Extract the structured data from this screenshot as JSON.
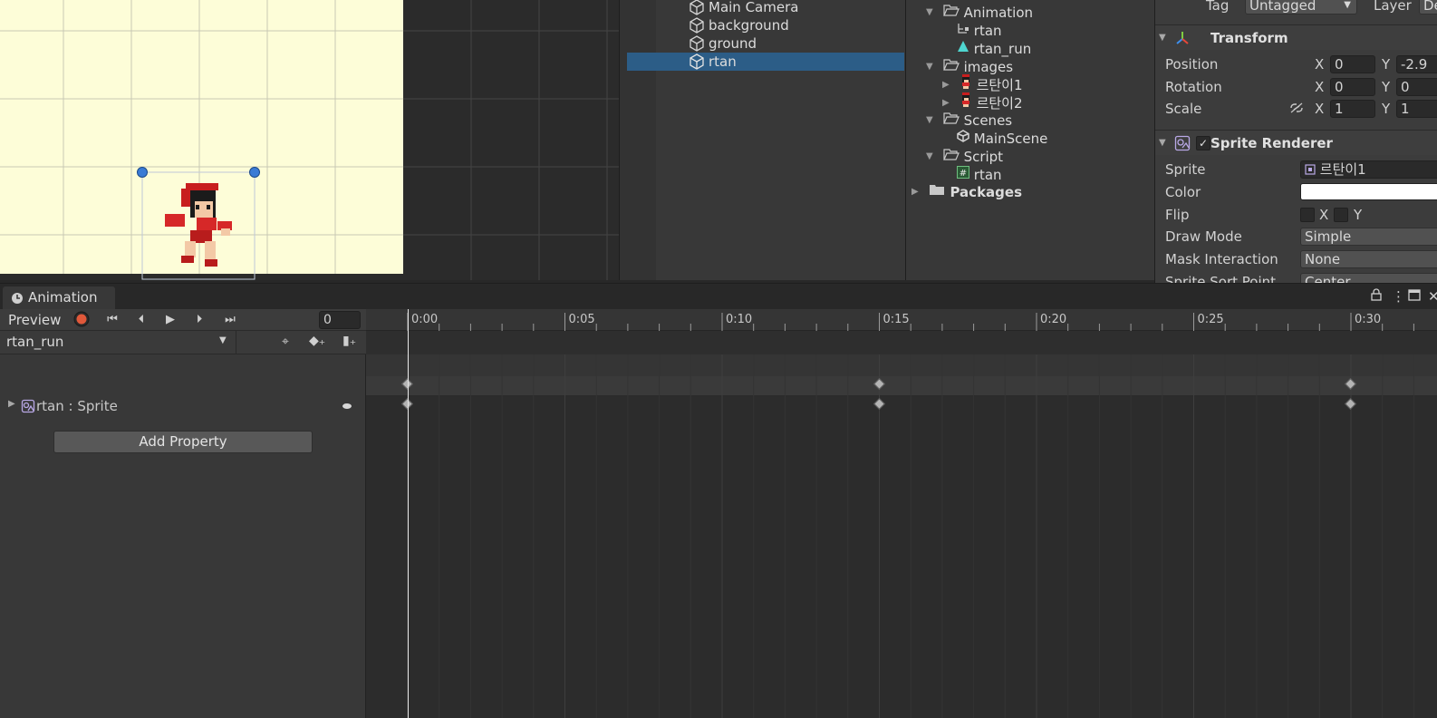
{
  "hierarchy": {
    "items": [
      {
        "label": "Main Camera",
        "selected": false
      },
      {
        "label": "background",
        "selected": false
      },
      {
        "label": "ground",
        "selected": false
      },
      {
        "label": "rtan",
        "selected": true
      }
    ]
  },
  "project": {
    "items": [
      {
        "label": "Animation",
        "kind": "folder-open",
        "indent": 1
      },
      {
        "label": "rtan",
        "kind": "animator-controller",
        "indent": 2
      },
      {
        "label": "rtan_run",
        "kind": "animation-clip",
        "indent": 2
      },
      {
        "label": "images",
        "kind": "folder-open",
        "indent": 1
      },
      {
        "label": "르탄이1",
        "kind": "sprite",
        "indent": 2
      },
      {
        "label": "르탄이2",
        "kind": "sprite",
        "indent": 2
      },
      {
        "label": "Scenes",
        "kind": "folder-open",
        "indent": 1
      },
      {
        "label": "MainScene",
        "kind": "scene",
        "indent": 2
      },
      {
        "label": "Script",
        "kind": "folder-open",
        "indent": 1
      },
      {
        "label": "rtan",
        "kind": "script",
        "indent": 2
      },
      {
        "label": "Packages",
        "kind": "folder-closed",
        "indent": 0
      }
    ]
  },
  "inspector": {
    "tag_label": "Tag",
    "tag_value": "Untagged",
    "layer_label": "Layer",
    "layer_value": "De",
    "transform": {
      "title": "Transform",
      "position_label": "Position",
      "rotation_label": "Rotation",
      "scale_label": "Scale",
      "x_label": "X",
      "y_label": "Y",
      "position_x": "0",
      "position_y": "-2.9",
      "rotation_x": "0",
      "rotation_y": "0",
      "scale_x": "1",
      "scale_y": "1"
    },
    "sprite_renderer": {
      "title": "Sprite Renderer",
      "sprite_label": "Sprite",
      "sprite_value": "르탄이1",
      "color_label": "Color",
      "flip_label": "Flip",
      "flip_x": "X",
      "flip_y": "Y",
      "draw_mode_label": "Draw Mode",
      "draw_mode_value": "Simple",
      "mask_label": "Mask Interaction",
      "mask_value": "None",
      "sort_point_label": "Sprite Sort Point",
      "sort_point_value": "Center"
    }
  },
  "animation": {
    "tab_label": "Animation",
    "preview_label": "Preview",
    "frame_value": "0",
    "clip_name": "rtan_run",
    "property_label": "rtan : Sprite",
    "add_property_label": "Add Property",
    "ruler_labels": [
      "0:00",
      "0:05",
      "0:10",
      "0:15",
      "0:20",
      "0:25",
      "0:30"
    ],
    "keyframe_times": [
      "0:00",
      "0:15",
      "0:30"
    ]
  },
  "colors": {
    "selection": "#2c5d87",
    "record": "#e0583a",
    "scene_background": "#fdfdd8",
    "handle": "#3a7bd5"
  }
}
